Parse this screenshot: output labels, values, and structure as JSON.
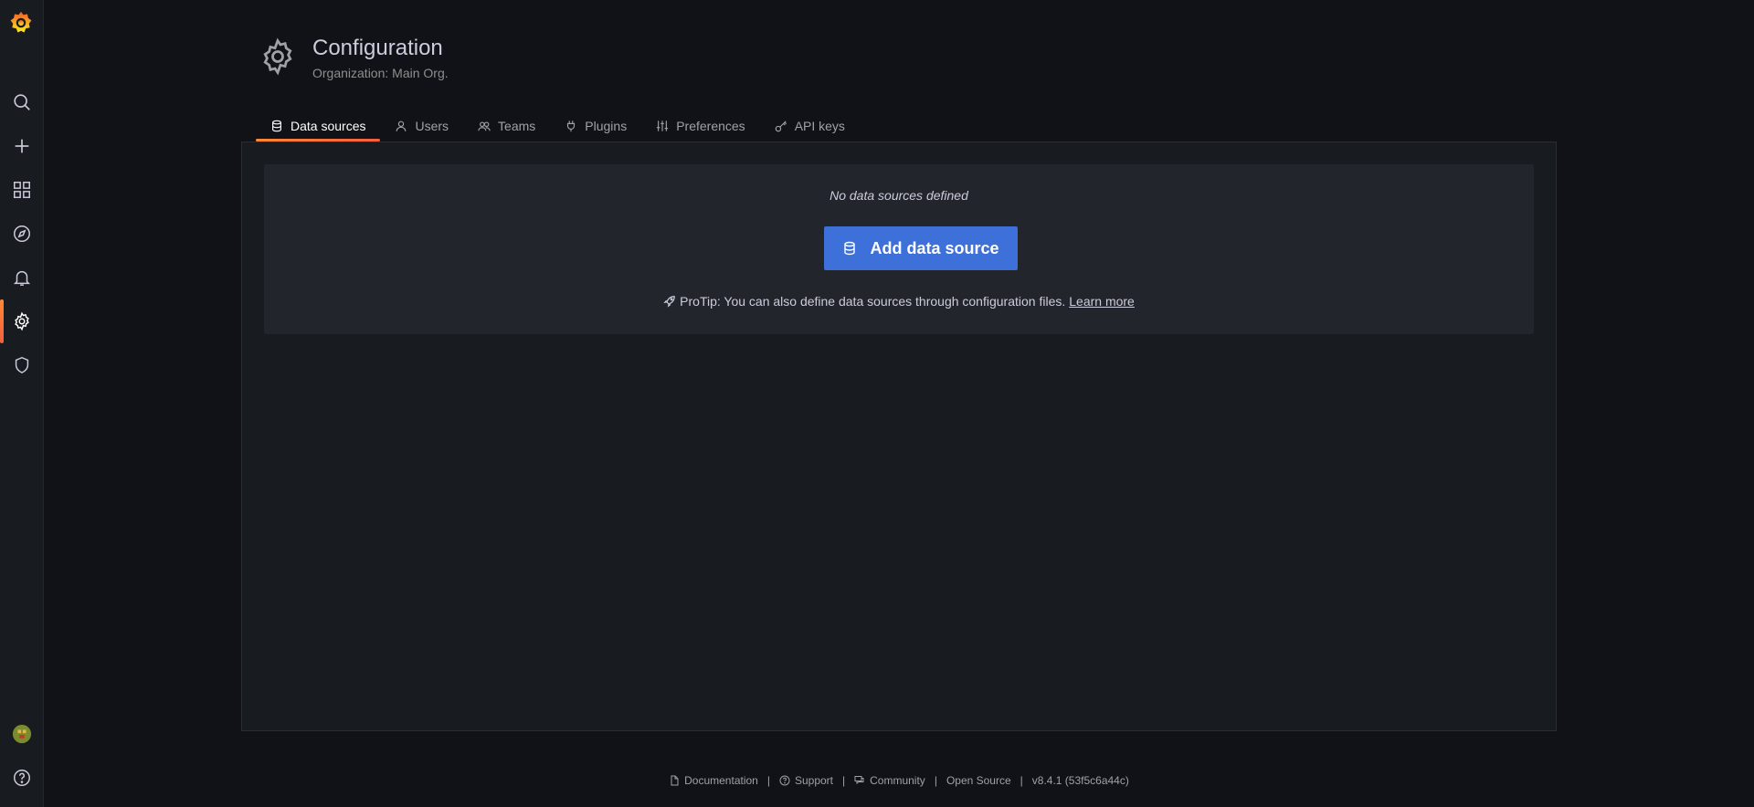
{
  "sidebar": {
    "items": [
      {
        "name": "search",
        "icon": "search-icon"
      },
      {
        "name": "create",
        "icon": "plus-icon"
      },
      {
        "name": "dashboards",
        "icon": "apps-icon"
      },
      {
        "name": "explore",
        "icon": "compass-icon"
      },
      {
        "name": "alerting",
        "icon": "bell-icon"
      },
      {
        "name": "configuration",
        "icon": "gear-icon",
        "active": true
      },
      {
        "name": "server-admin",
        "icon": "shield-icon"
      }
    ],
    "bottom": [
      {
        "name": "profile",
        "icon": "avatar"
      },
      {
        "name": "help",
        "icon": "question-circle-icon"
      }
    ]
  },
  "header": {
    "title": "Configuration",
    "subtitle": "Organization: Main Org."
  },
  "tabs": [
    {
      "label": "Data sources",
      "icon": "database-icon",
      "active": true
    },
    {
      "label": "Users",
      "icon": "user-icon"
    },
    {
      "label": "Teams",
      "icon": "users-icon"
    },
    {
      "label": "Plugins",
      "icon": "plug-icon"
    },
    {
      "label": "Preferences",
      "icon": "sliders-icon"
    },
    {
      "label": "API keys",
      "icon": "key-icon"
    }
  ],
  "empty_state": {
    "title": "No data sources defined",
    "button_label": "Add data source",
    "protip_text": "ProTip: You can also define data sources through configuration files.",
    "protip_link": "Learn more"
  },
  "footer": {
    "documentation": "Documentation",
    "support": "Support",
    "community": "Community",
    "open_source": "Open Source",
    "version": "v8.4.1 (53f5c6a44c)"
  },
  "colors": {
    "accent": "#ff8833",
    "primary_button": "#3d71d9",
    "background": "#111217",
    "panel": "#181b1f"
  }
}
